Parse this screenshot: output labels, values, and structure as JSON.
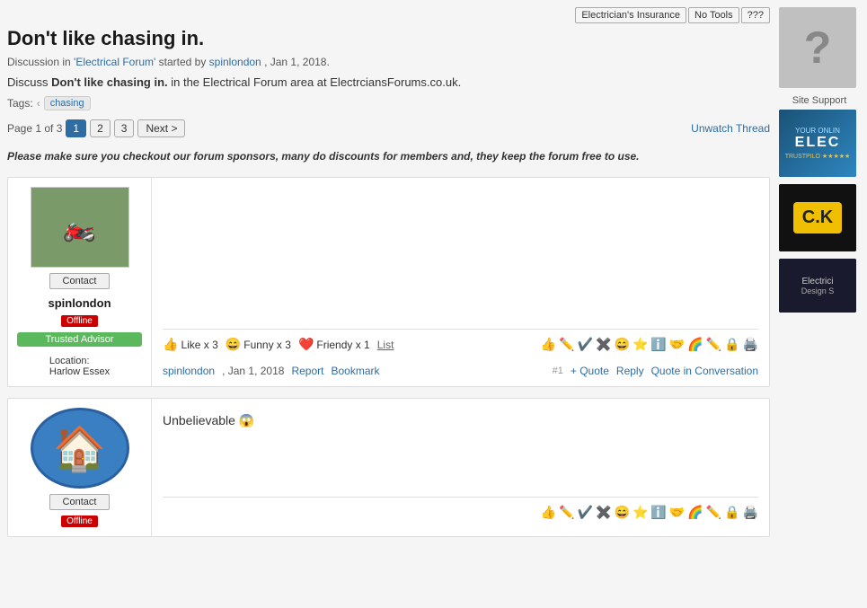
{
  "topbar": {
    "buttons": [
      "Electrician's Insurance",
      "No Tools",
      "???"
    ]
  },
  "thread": {
    "title": "Don't like chasing in.",
    "meta_prefix": "Discussion in ",
    "forum_name": "'Electrical Forum'",
    "meta_suffix": " started by ",
    "author": "spinlondon",
    "date": ", Jan 1, 2018.",
    "desc_prefix": "Discuss ",
    "desc_bold": "Don't like chasing in.",
    "desc_suffix": " in the Electrical Forum area at ElectrciansForum​s.co.uk.",
    "tags_label": "Tags:",
    "tags": [
      "chasing"
    ],
    "pagination_prefix": "Page 1 of 3",
    "pages": [
      "1",
      "2",
      "3"
    ],
    "next_label": "Next >",
    "unwatch_label": "Unwatch Thread",
    "sponsor_notice": "Please make sure you checkout our forum sponsors, many do discounts for members and, they keep the forum free to use."
  },
  "post1": {
    "contact_label": "Contact",
    "username": "spinlondon",
    "offline_label": "Offline",
    "trusted_label": "Trusted Advisor",
    "location_label": "Location:",
    "location_value": "Harlow Essex",
    "reactions": {
      "like_emoji": "👍",
      "like_label": "Like x 3",
      "funny_emoji": "😄",
      "funny_label": "Funny x 3",
      "friendly_emoji": "❤️",
      "friendly_label": "Friendy x 1",
      "list_label": "List"
    },
    "footer_author": "spinlondon",
    "footer_date": ", Jan 1, 2018",
    "report_label": "Report",
    "bookmark_label": "Bookmark",
    "post_num": "#1",
    "quote_label": "+ Quote",
    "reply_label": "Reply",
    "quote_conv_label": "Quote in Conversation"
  },
  "post2": {
    "contact_label": "Contact",
    "offline_label": "Offline",
    "content": "Unbelievable 😱"
  },
  "sidebar": {
    "support_label": "Site Support",
    "ad1_text": "YOUR ONLIN",
    "ad1_main": "ELEC",
    "ad1_trustpilot": "TRUSTPILO ★★★★★",
    "ad2_logo": "C.K",
    "ad3_text": "Electrici Design S"
  },
  "icons": {
    "reaction_icons": [
      "👍",
      "✏️",
      "✔️",
      "✖️",
      "😄",
      "🌟",
      "ℹ️",
      "🤝",
      "🌈",
      "✏️",
      "🔒",
      "🖨️"
    ],
    "post2_reaction_icons": [
      "👍",
      "✏️",
      "✔️",
      "✖️",
      "😄",
      "🌟",
      "ℹ️",
      "🤝",
      "🌈",
      "✏️",
      "🔒",
      "🖨️"
    ]
  }
}
